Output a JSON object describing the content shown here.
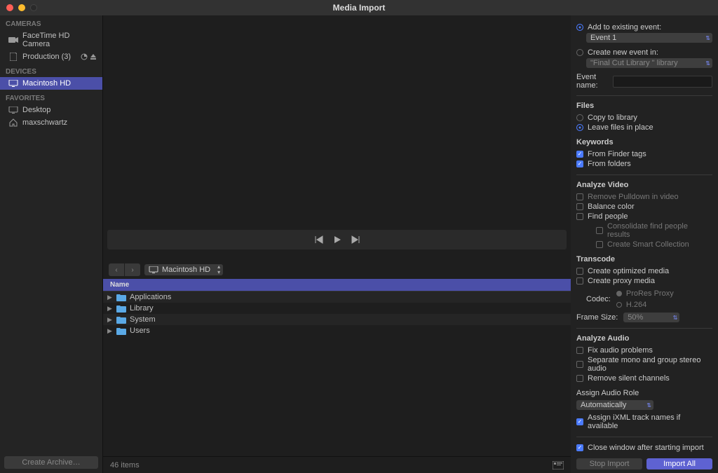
{
  "title": "Media Import",
  "sidebar": {
    "sections": [
      {
        "header": "CAMERAS",
        "items": [
          {
            "icon": "camera",
            "label": "FaceTime HD Camera"
          },
          {
            "icon": "sd-card",
            "label": "Production (3)",
            "badges": true
          }
        ]
      },
      {
        "header": "DEVICES",
        "items": [
          {
            "icon": "display",
            "label": "Macintosh HD",
            "selected": true
          }
        ]
      },
      {
        "header": "FAVORITES",
        "items": [
          {
            "icon": "display",
            "label": "Desktop"
          },
          {
            "icon": "home",
            "label": "maxschwartz"
          }
        ]
      }
    ],
    "create_archive": "Create Archive…"
  },
  "pathbar": {
    "label": "Macintosh HD"
  },
  "table": {
    "header_name": "Name"
  },
  "files": [
    {
      "name": "Applications"
    },
    {
      "name": "Library"
    },
    {
      "name": "System"
    },
    {
      "name": "Users"
    }
  ],
  "footer": {
    "item_count": "46 items"
  },
  "right": {
    "add_existing": {
      "label": "Add to existing event:",
      "value": "Event 1"
    },
    "new_event": {
      "label": "Create new event in:",
      "value": "\"Final Cut Library \" library"
    },
    "event_name_label": "Event name:",
    "files_header": "Files",
    "copy_to_library": "Copy to library",
    "leave_in_place": "Leave files in place",
    "keywords_header": "Keywords",
    "from_finder": "From Finder tags",
    "from_folders": "From folders",
    "analyze_video_header": "Analyze Video",
    "remove_pulldown": "Remove Pulldown in video",
    "balance_color": "Balance color",
    "find_people": "Find people",
    "consolidate": "Consolidate find people results",
    "smart_collection": "Create Smart Collection",
    "transcode_header": "Transcode",
    "optimized": "Create optimized media",
    "proxy": "Create proxy media",
    "codec_label": "Codec:",
    "codec_prores": "ProRes Proxy",
    "codec_h264": "H.264",
    "frame_size_label": "Frame Size:",
    "frame_size_value": "50%",
    "analyze_audio_header": "Analyze Audio",
    "fix_audio": "Fix audio problems",
    "separate_mono": "Separate mono and group stereo audio",
    "remove_silent": "Remove silent channels",
    "assign_role_header": "Assign Audio Role",
    "assign_role_value": "Automatically",
    "assign_ixml": "Assign iXML track names if available",
    "close_window": "Close window after starting import",
    "stop_import": "Stop Import",
    "import_all": "Import All"
  }
}
